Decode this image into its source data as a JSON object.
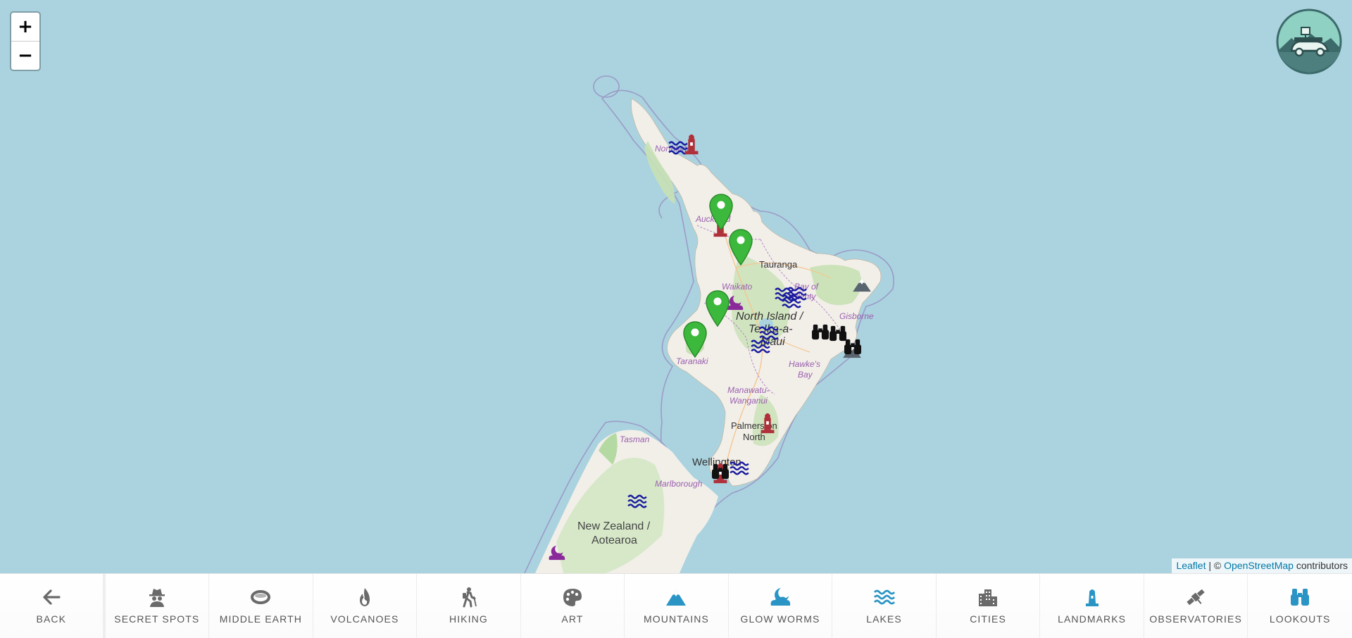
{
  "map": {
    "zoom_in_label": "+",
    "zoom_out_label": "−",
    "place_labels": {
      "north_island": "North Island /",
      "north_island_2": "Te Ika-a-",
      "north_island_3": "Māui",
      "auckland": "Auckland",
      "northland": "Northland",
      "tauranga": "Tauranga",
      "bay_of_plenty": "Bay of",
      "bay_of_plenty_2": "Plenty",
      "waikato": "Waikato",
      "gisborne": "Gisborne",
      "taranaki": "Taranaki",
      "hawkes_bay": "Hawke's",
      "hawkes_bay_2": "Bay",
      "manawatu": "Manawatu-",
      "manawatu_2": "Wanganui",
      "palmerston": "Palmerston",
      "palmerston_2": "North",
      "wellington": "Wellington",
      "tasman": "Tasman",
      "marlborough": "Marlborough",
      "new_zealand": "New Zealand /",
      "aotearoa": "Aotearoa"
    },
    "marker_colors": {
      "pin": "#3cb93c",
      "landmark": "#b0303a",
      "lake": "#1a1aa0",
      "glow_worm": "#8a2a9a",
      "mountain": "#5a6470",
      "lookout": "#111111"
    },
    "marker_icons": [
      "map-pin-icon",
      "landmark-icon",
      "lake-icon",
      "glow-worm-icon",
      "mountain-icon",
      "lookout-icon"
    ]
  },
  "attribution": {
    "leaflet": "Leaflet",
    "separator": " | © ",
    "osm": "OpenStreetMap",
    "suffix": " contributors"
  },
  "toolbar": {
    "items": [
      {
        "label": "BACK",
        "icon": "arrow-left-icon"
      },
      {
        "label": "SECRET SPOTS",
        "icon": "spy-icon"
      },
      {
        "label": "MIDDLE EARTH",
        "icon": "ring-icon"
      },
      {
        "label": "VOLCANOES",
        "icon": "fire-icon"
      },
      {
        "label": "HIKING",
        "icon": "hiker-icon"
      },
      {
        "label": "ART",
        "icon": "palette-icon"
      },
      {
        "label": "MOUNTAINS",
        "icon": "mountain-icon"
      },
      {
        "label": "GLOW WORMS",
        "icon": "moon-cloud-icon"
      },
      {
        "label": "LAKES",
        "icon": "water-icon"
      },
      {
        "label": "CITIES",
        "icon": "city-icon"
      },
      {
        "label": "LANDMARKS",
        "icon": "lighthouse-icon"
      },
      {
        "label": "OBSERVATORIES",
        "icon": "satellite-icon"
      },
      {
        "label": "LOOKOUTS",
        "icon": "binoculars-icon"
      }
    ],
    "active_color": "#2a95c5",
    "inactive_color": "#6a6a6a"
  }
}
